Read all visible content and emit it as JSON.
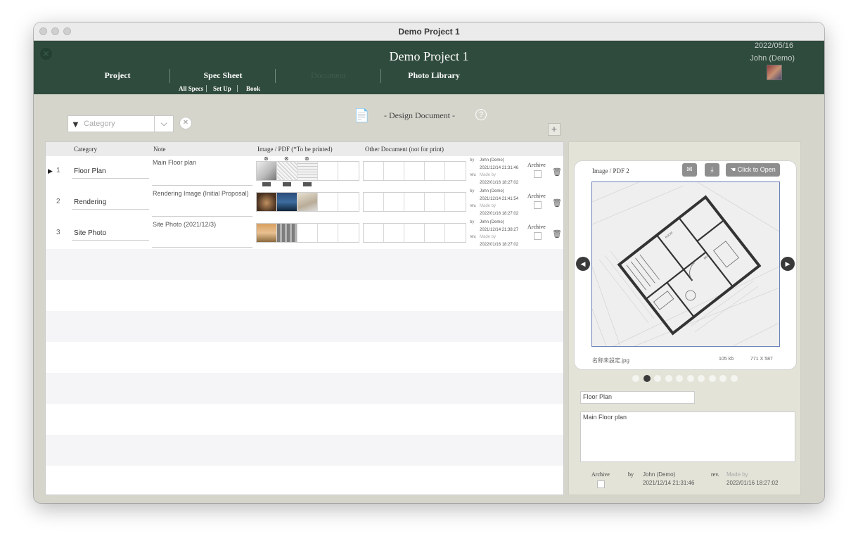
{
  "window": {
    "title": "Demo Project 1"
  },
  "header": {
    "title": "Demo Project 1",
    "date": "2022/05/16",
    "user": "John (Demo)",
    "nav": [
      {
        "label": "Project"
      },
      {
        "label": "Spec Sheet"
      },
      {
        "label": "Document"
      },
      {
        "label": "Photo Library"
      }
    ],
    "subnav": [
      {
        "label": "All Specs"
      },
      {
        "label": "Set Up"
      },
      {
        "label": "Book"
      }
    ]
  },
  "toolbar": {
    "filter_placeholder": "Category",
    "section_title": "- Design Document -"
  },
  "table": {
    "columns": {
      "category": "Category",
      "note": "Note",
      "image": "Image / PDF (*To be printed)",
      "other": "Other Document (not for print)"
    },
    "rows": [
      {
        "num": "1",
        "category": "Floor Plan",
        "note": "Main Floor plan",
        "by_label": "by",
        "by_name": "John (Demo)",
        "by_date": "2021/12/14 21:31:46",
        "rev_label": "rev.",
        "rev_name": "Made by",
        "rev_date": "2022/01/16 18:27:02",
        "archive": "Archive"
      },
      {
        "num": "2",
        "category": "Rendering",
        "note": "Rendering Image (Initial Proposal)",
        "by_label": "by",
        "by_name": "John (Demo)",
        "by_date": "2021/12/14 21:41:54",
        "rev_label": "rev.",
        "rev_name": "Made by",
        "rev_date": "2022/01/16 18:27:02",
        "archive": "Archive"
      },
      {
        "num": "3",
        "category": "Site Photo",
        "note": "Site Photo (2021/12/3)",
        "by_label": "by",
        "by_name": "John (Demo)",
        "by_date": "2021/12/14 21:38:27",
        "rev_label": "rev.",
        "rev_name": "Made by",
        "rev_date": "2022/01/16 18:27:02",
        "archive": "Archive"
      }
    ]
  },
  "detail": {
    "title": "Image / PDF 2",
    "open_label": "Click to Open",
    "filename": "名称未設定.jpg",
    "filesize": "105 kb",
    "dimensions": "771  X  587",
    "page_count": 10,
    "current_page": 2,
    "category": "Floor Plan",
    "note": "Main Floor plan",
    "archive_label": "Archive",
    "by_label": "by",
    "by_name": "John (Demo)",
    "by_date": "2021/12/14 21:31:46",
    "rev_label": "rev.",
    "rev_name": "Made by",
    "rev_date": "2022/01/16 18:27:02"
  },
  "colors": {
    "header_bg": "#2f4b3d",
    "body_bg": "#d6d5cc",
    "panel_bg": "#e4e3d8",
    "button_gray": "#8e8e8e"
  }
}
